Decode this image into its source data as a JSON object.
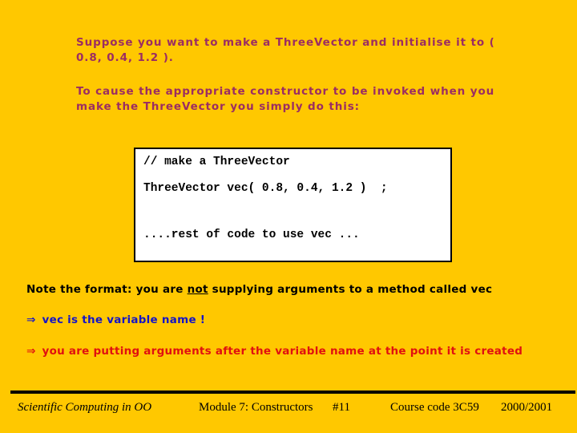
{
  "theme": {
    "background": "#FFC800",
    "intro_text": "#9B2D62",
    "code_text": "#000000",
    "code_background": "#FFFFFF",
    "code_border": "#000000",
    "note_black": "#000000",
    "note_blue": "#1414C8",
    "note_red": "#E01010",
    "footer_text": "#000000",
    "rule": "#000000"
  },
  "intro": {
    "para1": "Suppose you want to make a ThreeVector and initialise it to ( 0.8, 0.4, 1.2 ).",
    "para2": "To cause the appropriate constructor to be invoked when you make the ThreeVector you simply do this:"
  },
  "code": {
    "line1": "// make a ThreeVector",
    "line2": "ThreeVector vec( 0.8, 0.4, 1.2 )  ;",
    "line3": "....rest of code to use vec ..."
  },
  "notes": {
    "black": {
      "before": "Note the format: you are ",
      "emphasis": "not",
      "after": " supplying arguments to a method called vec"
    },
    "blue": {
      "arrow": "⇒",
      "text": " vec is the variable name !"
    },
    "red": {
      "arrow": "⇒",
      "text": " you are putting arguments after the variable name at the point it is created"
    }
  },
  "footer": {
    "course_title": "Scientific Computing in OO",
    "module": "Module 7: Constructors",
    "page_number": "#11",
    "course_code": "Course code 3C59",
    "academic_year": "2000/2001"
  }
}
